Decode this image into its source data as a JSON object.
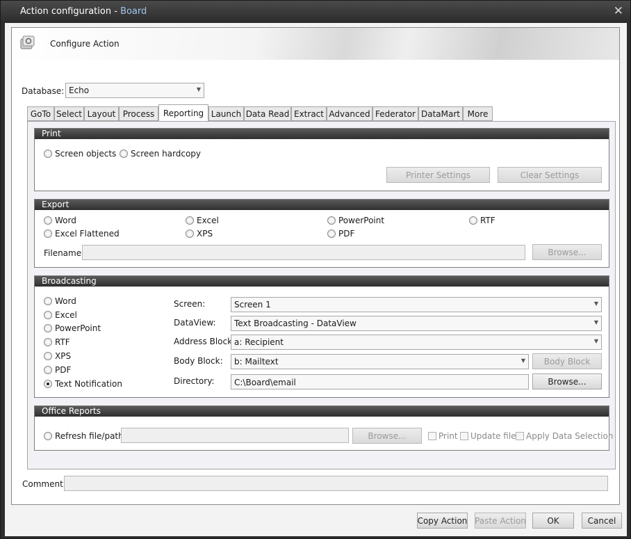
{
  "window": {
    "title": "Action configuration",
    "title_suffix": "Board"
  },
  "banner": {
    "title": "Configure Action"
  },
  "database": {
    "label": "Database:",
    "value": "Echo"
  },
  "tabs": [
    "GoTo",
    "Select",
    "Layout",
    "Process",
    "Reporting",
    "Launch",
    "Data Read",
    "Extract",
    "Advanced",
    "Federator",
    "DataMart",
    "More"
  ],
  "active_tab": "Reporting",
  "print": {
    "header": "Print",
    "options": [
      "Screen objects",
      "Screen hardcopy"
    ],
    "printer_settings": "Printer Settings",
    "clear_settings": "Clear Settings"
  },
  "export": {
    "header": "Export",
    "options": [
      "Word",
      "Excel",
      "PowerPoint",
      "RTF",
      "Excel Flattened",
      "XPS",
      "PDF"
    ],
    "filename_label": "Filename:",
    "filename_value": "",
    "browse": "Browse..."
  },
  "broadcasting": {
    "header": "Broadcasting",
    "options": [
      "Word",
      "Excel",
      "PowerPoint",
      "RTF",
      "XPS",
      "PDF",
      "Text Notification"
    ],
    "selected": "Text Notification",
    "screen_label": "Screen:",
    "screen_value": "Screen 1",
    "dataview_label": "DataView:",
    "dataview_value": "Text Broadcasting - DataView",
    "address_label": "Address Block:",
    "address_value": "a: Recipient",
    "body_label": "Body Block:",
    "body_value": "b: Mailtext",
    "body_block_button": "Body Block",
    "directory_label": "Directory:",
    "directory_value": "C:\\Board\\email",
    "browse": "Browse..."
  },
  "office_reports": {
    "header": "Office Reports",
    "refresh_label": "Refresh file/path",
    "path_value": "",
    "browse": "Browse...",
    "print": "Print",
    "update_file": "Update file",
    "apply_selection": "Apply Data Selection"
  },
  "comment": {
    "label": "Comment:",
    "value": ""
  },
  "footer": {
    "copy": "Copy Action",
    "paste": "Paste Action",
    "ok": "OK",
    "cancel": "Cancel"
  }
}
